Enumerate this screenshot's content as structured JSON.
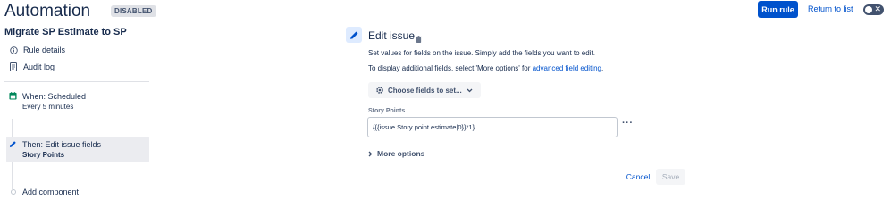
{
  "header": {
    "title": "Automation",
    "status_badge": "DISABLED",
    "run_rule_label": "Run rule",
    "return_label": "Return to list",
    "toggle_icon": "x-icon",
    "toggle_state": "off"
  },
  "sidebar": {
    "rule_name": "Migrate SP Estimate to SP",
    "nav": [
      {
        "label": "Rule details",
        "icon": "info-icon"
      },
      {
        "label": "Audit log",
        "icon": "document-icon"
      }
    ],
    "steps": [
      {
        "title": "When: Scheduled",
        "subtitle": "Every 5 minutes",
        "icon": "calendar-icon"
      },
      {
        "title": "Then: Edit issue fields",
        "subtitle": "Story Points",
        "icon": "pencil-icon"
      }
    ],
    "add_component": "Add component"
  },
  "main": {
    "title": "Edit issue",
    "desc1": "Set values for fields on the issue. Simply add the fields you want to edit.",
    "desc2_prefix": "To display additional fields, select 'More options' for ",
    "desc2_link": "advanced field editing",
    "desc2_suffix": ".",
    "choose_fields_label": "Choose fields to set...",
    "field": {
      "label": "Story Points",
      "value": "{{{issue.Story point estimate|0}}*1}"
    },
    "more_options_label": "More options",
    "cancel_label": "Cancel",
    "save_label": "Save"
  },
  "colors": {
    "primary": "#0052cc",
    "text": "#172b4d",
    "selected_bg": "#ebecf0",
    "badge_bg": "#dfe1e6",
    "calendar_green": "#00875a"
  }
}
